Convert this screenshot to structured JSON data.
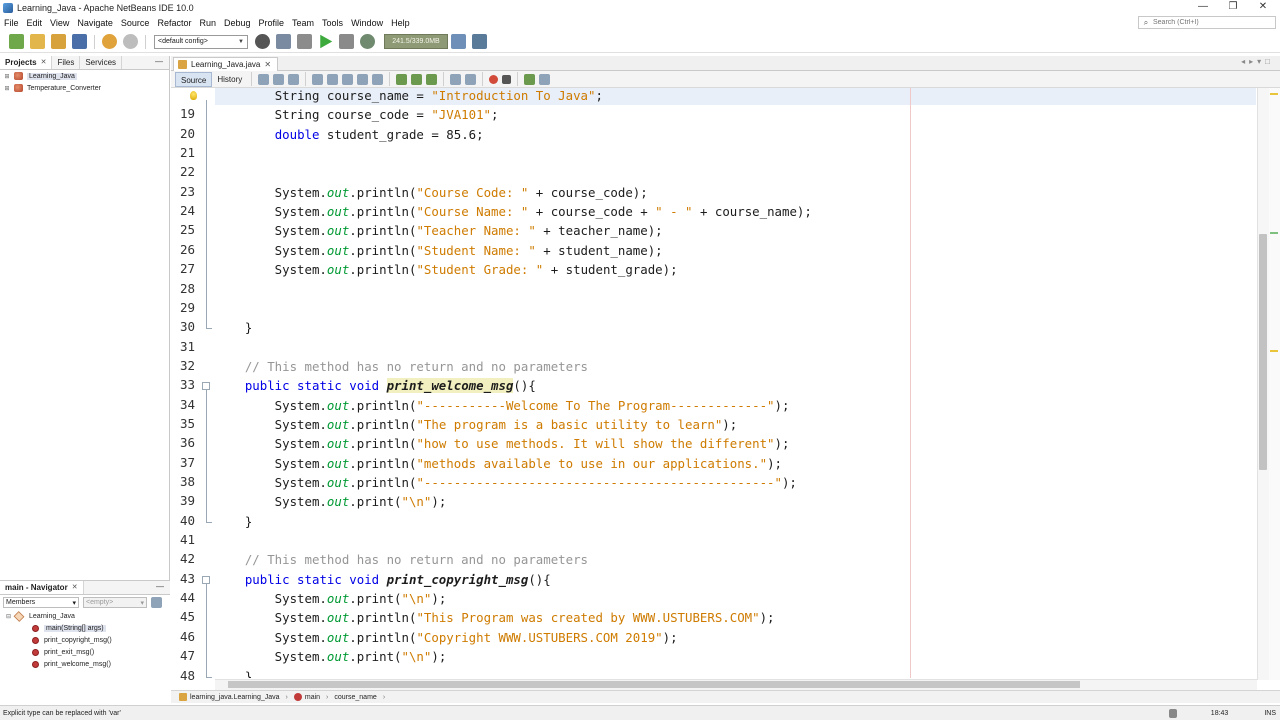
{
  "window": {
    "title": "Learning_Java - Apache NetBeans IDE 10.0",
    "controls": [
      "—",
      "❐",
      "✕"
    ]
  },
  "menu": [
    "File",
    "Edit",
    "View",
    "Navigate",
    "Source",
    "Refactor",
    "Run",
    "Debug",
    "Profile",
    "Team",
    "Tools",
    "Window",
    "Help"
  ],
  "search": {
    "placeholder": "Search (Ctrl+I)"
  },
  "toolbar": {
    "config": "<default config>",
    "memory": "241.5/339.0MB"
  },
  "projects_panel": {
    "tabs": [
      "Projects",
      "Files",
      "Services"
    ],
    "items": [
      {
        "label": "Learning_Java",
        "selected": true
      },
      {
        "label": "Temperature_Converter",
        "selected": false
      }
    ]
  },
  "navigator": {
    "title": "main - Navigator",
    "filter": "Members",
    "filter2": "<empty>",
    "root": "Learning_Java",
    "members": [
      "main(String[] args)",
      "print_copyright_msg()",
      "print_exit_msg()",
      "print_welcome_msg()"
    ]
  },
  "editor": {
    "file_tab": "Learning_Java.java",
    "view_tabs": [
      "Source",
      "History"
    ],
    "lines": [
      {
        "n": "",
        "html": "        <span>String course_name = </span><span class=\"str\">\"Introduction To Java\"</span>;",
        "current": true
      },
      {
        "n": "19",
        "html": "        String course_code = <span class=\"str\">\"JVA101\"</span>;"
      },
      {
        "n": "20",
        "html": "        <span class=\"kw\">double</span> student_grade = 85.6;"
      },
      {
        "n": "21",
        "html": ""
      },
      {
        "n": "22",
        "html": ""
      },
      {
        "n": "23",
        "html": "        System.<span class=\"st\">out</span>.println(<span class=\"str\">\"Course Code: \"</span> + course_code);"
      },
      {
        "n": "24",
        "html": "        System.<span class=\"st\">out</span>.println(<span class=\"str\">\"Course Name: \"</span> + course_code + <span class=\"str\">\" - \"</span> + course_name);"
      },
      {
        "n": "25",
        "html": "        System.<span class=\"st\">out</span>.println(<span class=\"str\">\"Teacher Name: \"</span> + teacher_name);"
      },
      {
        "n": "26",
        "html": "        System.<span class=\"st\">out</span>.println(<span class=\"str\">\"Student Name: \"</span> + student_name);"
      },
      {
        "n": "27",
        "html": "        System.<span class=\"st\">out</span>.println(<span class=\"str\">\"Student Grade: \"</span> + student_grade);"
      },
      {
        "n": "28",
        "html": ""
      },
      {
        "n": "29",
        "html": ""
      },
      {
        "n": "30",
        "html": "    }"
      },
      {
        "n": "31",
        "html": ""
      },
      {
        "n": "32",
        "html": "    <span class=\"cm\">// This method has no return and no parameters</span>"
      },
      {
        "n": "33",
        "html": "    <span class=\"kw\">public static void</span> <span class=\"mth hl\">print_welcome_msg</span>(){"
      },
      {
        "n": "34",
        "html": "        System.<span class=\"st\">out</span>.println(<span class=\"str\">\"-----------Welcome To The Program-------------\"</span>);"
      },
      {
        "n": "35",
        "html": "        System.<span class=\"st\">out</span>.println(<span class=\"str\">\"The program is a basic utility to learn\"</span>);"
      },
      {
        "n": "36",
        "html": "        System.<span class=\"st\">out</span>.println(<span class=\"str\">\"how to use methods. It will show the different\"</span>);"
      },
      {
        "n": "37",
        "html": "        System.<span class=\"st\">out</span>.println(<span class=\"str\">\"methods available to use in our applications.\"</span>);"
      },
      {
        "n": "38",
        "html": "        System.<span class=\"st\">out</span>.println(<span class=\"str\">\"-----------------------------------------------\"</span>);"
      },
      {
        "n": "39",
        "html": "        System.<span class=\"st\">out</span>.print(<span class=\"str\">\"\\n\"</span>);"
      },
      {
        "n": "40",
        "html": "    }"
      },
      {
        "n": "41",
        "html": ""
      },
      {
        "n": "42",
        "html": "    <span class=\"cm\">// This method has no return and no parameters</span>"
      },
      {
        "n": "43",
        "html": "    <span class=\"kw\">public static void</span> <span class=\"mth\">print_copyright_msg</span>(){"
      },
      {
        "n": "44",
        "html": "        System.<span class=\"st\">out</span>.print(<span class=\"str\">\"\\n\"</span>);"
      },
      {
        "n": "45",
        "html": "        System.<span class=\"st\">out</span>.println(<span class=\"str\">\"This Program was created by WWW.USTUBERS.COM\"</span>);"
      },
      {
        "n": "46",
        "html": "        System.<span class=\"st\">out</span>.println(<span class=\"str\">\"Copyright WWW.USTUBERS.COM 2019\"</span>);"
      },
      {
        "n": "47",
        "html": "        System.<span class=\"st\">out</span>.print(<span class=\"str\">\"\\n\"</span>);"
      },
      {
        "n": "48",
        "html": "    }"
      }
    ]
  },
  "breadcrumb": [
    "learning_java.Learning_Java",
    "main",
    "course_name"
  ],
  "status": {
    "message": "Explicit type can be replaced with 'var'",
    "time": "18:43",
    "mode": "INS"
  },
  "colors": {
    "keyword": "#0000e6",
    "string": "#ce7b00",
    "comment": "#969696",
    "static_field": "#009933"
  }
}
